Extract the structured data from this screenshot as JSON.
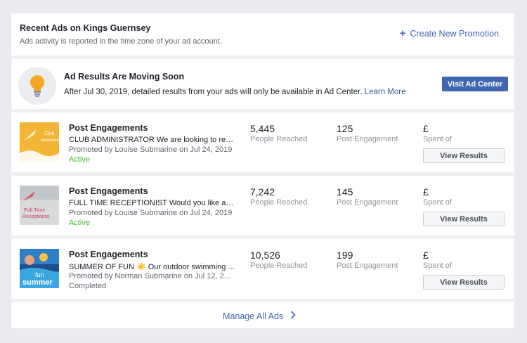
{
  "header": {
    "title": "Recent Ads on Kings Guernsey",
    "subtitle": "Ads activity is reported in the time zone of your ad account.",
    "create_label": "Create New Promotion"
  },
  "notice": {
    "icon": "lightbulb-icon",
    "title": "Ad Results Are Moving Soon",
    "text": "After Jul 30, 2019, detailed results from your ads will only be available in Ad Center.",
    "learn_more": "Learn More",
    "button_label": "Visit Ad Center"
  },
  "ads": [
    {
      "title": "Post Engagements",
      "description": "CLUB ADMINISTRATOR We are looking to rec...",
      "promoted": "Promoted by Louise Submarine on Jul 24, 2019",
      "status": "Active",
      "reached": "5,445",
      "reached_label": "People Reached",
      "engagement": "125",
      "engagement_label": "Post Engagement",
      "currency": "£",
      "spent_label": "Spent of",
      "button_label": "View Results",
      "thumb_text": "Club Administrator"
    },
    {
      "title": "Post Engagements",
      "description": "FULL TIME RECEPTIONIST Would you like a c...",
      "promoted": "Promoted by Louise Submarine on Jul 24, 2019",
      "status": "Active",
      "reached": "7,242",
      "reached_label": "People Reached",
      "engagement": "145",
      "engagement_label": "Post Engagement",
      "currency": "£",
      "spent_label": "Spent of",
      "button_label": "View Results",
      "thumb_text": "Full Time Receptionist"
    },
    {
      "title": "Post Engagements",
      "description": "SUMMER OF FUN ☀️ Our outdoor swimming ...",
      "promoted": "Promoted by Norman Submarine on Jul 12, 2...",
      "status": "Completed",
      "reached": "10,526",
      "reached_label": "People Reached",
      "engagement": "199",
      "engagement_label": "Post Engagement",
      "currency": "£",
      "spent_label": "Spent of",
      "button_label": "View Results",
      "thumb_text": "fun summer"
    }
  ],
  "footer": {
    "manage_label": "Manage All Ads"
  },
  "colors": {
    "accent": "#4267b2",
    "active": "#42b72a",
    "background": "#e9ebee"
  }
}
